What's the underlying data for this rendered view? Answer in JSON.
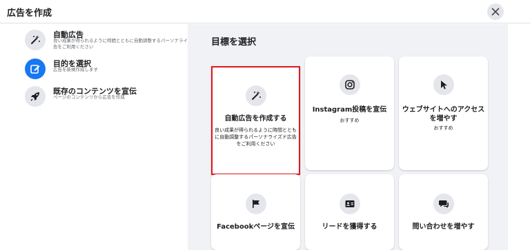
{
  "header": {
    "title": "広告を作成"
  },
  "sidebar": {
    "items": [
      {
        "label": "自動広告",
        "desc": "良い成果が得られるように時間とともに自動調整するパーソナライズド広告をご利用ください",
        "icon": "magic-wand-icon",
        "active": false
      },
      {
        "label": "目的を選択",
        "desc": "広告を新規作成します",
        "icon": "edit-icon",
        "active": true
      },
      {
        "label": "既存のコンテンツを宣伝",
        "desc": "ページのコンテンツから広告を作成",
        "icon": "rocket-icon",
        "active": false
      }
    ]
  },
  "main": {
    "title": "目標を選択",
    "cards": [
      {
        "title": "自動広告を作成する",
        "desc": "良い成果が得られるように時間とともに自動調整するパーソナライズド広告をご利用ください",
        "icon": "magic-wand-icon",
        "selected": true
      },
      {
        "title": "Instagram投稿を宣伝",
        "sub": "おすすめ",
        "icon": "instagram-icon"
      },
      {
        "title": "ウェブサイトへのアクセスを増やす",
        "sub": "おすすめ",
        "icon": "cursor-icon"
      },
      {
        "title": "Facebookページを宣伝",
        "icon": "flag-icon"
      },
      {
        "title": "リードを獲得する",
        "icon": "contact-card-icon"
      },
      {
        "title": "問い合わせを増やす",
        "icon": "chat-icon"
      }
    ]
  },
  "colors": {
    "accent": "#1877f2",
    "selected_border": "#e0161b",
    "panel_bg": "#f0f2f5"
  }
}
